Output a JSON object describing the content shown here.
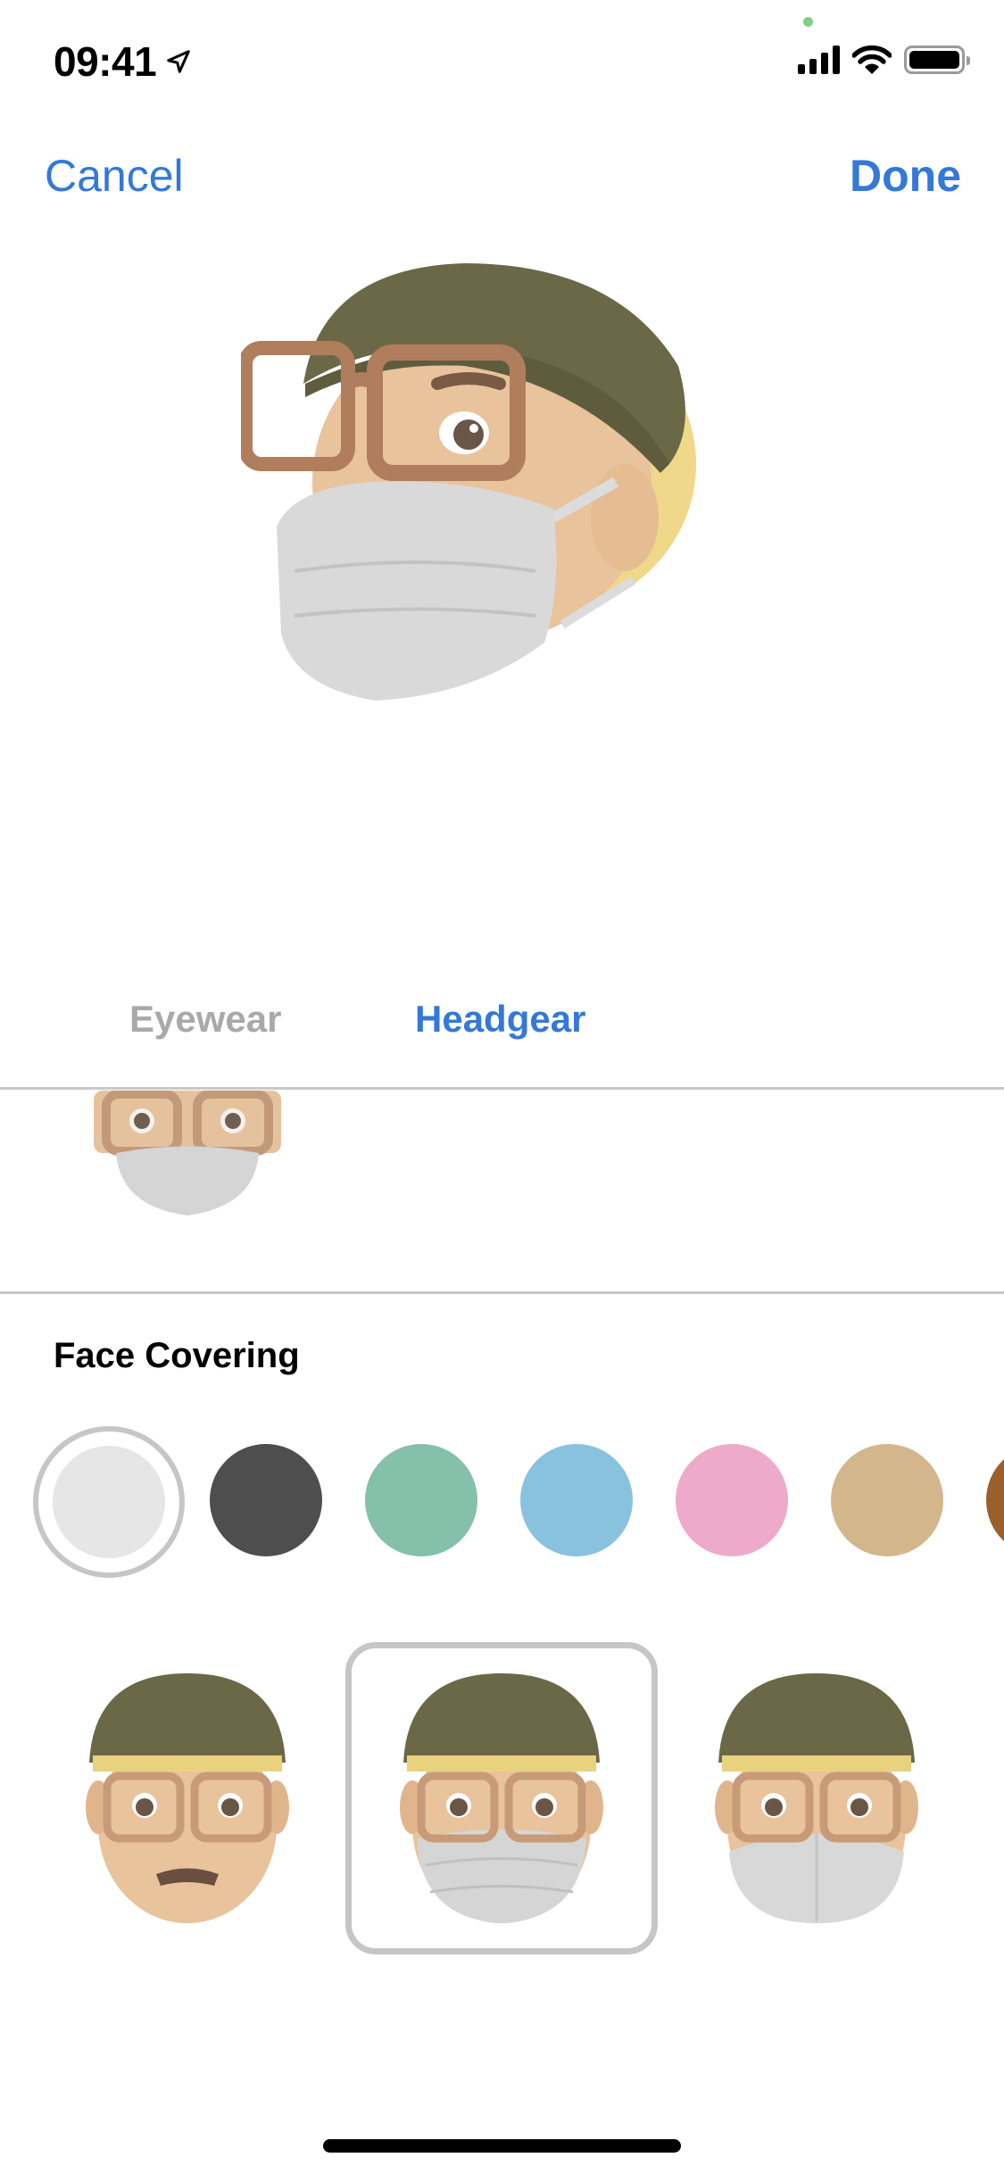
{
  "status_bar": {
    "time": "09:41",
    "location_icon": "location-arrow-icon",
    "signal_icon": "cellular-signal-icon",
    "wifi_icon": "wifi-icon",
    "battery_icon": "battery-icon",
    "camera_indicator_color": "#7fcf87"
  },
  "nav": {
    "cancel_label": "Cancel",
    "done_label": "Done",
    "accent_color": "#3478d8"
  },
  "preview": {
    "description": "Memoji with olive beanie, brown glasses, gray face mask"
  },
  "tabs": [
    {
      "label": "Eyewear",
      "active": false
    },
    {
      "label": "Headgear",
      "active": true
    }
  ],
  "face_covering": {
    "title": "Face Covering",
    "colors": [
      {
        "name": "light-gray",
        "hex": "#e6e6e6",
        "selected": true
      },
      {
        "name": "dark-gray",
        "hex": "#4e4e4e",
        "selected": false
      },
      {
        "name": "teal",
        "hex": "#84c0aa",
        "selected": false
      },
      {
        "name": "blue",
        "hex": "#88c2de",
        "selected": false
      },
      {
        "name": "pink",
        "hex": "#eeaaca",
        "selected": false
      },
      {
        "name": "tan",
        "hex": "#d4b68c",
        "selected": false
      },
      {
        "name": "brown",
        "hex": "#9a5f2c",
        "selected": false
      }
    ],
    "options": [
      {
        "name": "none",
        "selected": false
      },
      {
        "name": "cloth-mask",
        "selected": true
      },
      {
        "name": "n95-mask",
        "selected": false
      }
    ]
  }
}
